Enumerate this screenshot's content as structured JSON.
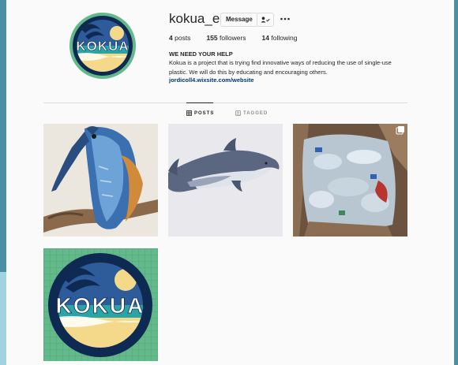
{
  "profile": {
    "username": "kokua_es",
    "avatar_logo_text": "KOKUA",
    "message_label": "Message",
    "posts_count": "4",
    "posts_label": "posts",
    "followers_count": "155",
    "followers_label": "followers",
    "following_count": "14",
    "following_label": "following",
    "bio_title": "WE NEED YOUR HELP",
    "bio_text": "Kokua is a project that is trying find innovative ways of reducing the use of single-use plastic. We will do this by educating and encouraging others.",
    "website": "jordicoll4.wixsite.com/website"
  },
  "tabs": [
    {
      "label": "POSTS",
      "icon": "grid-icon",
      "active": true
    },
    {
      "label": "TAGGED",
      "icon": "tag-icon",
      "active": false
    }
  ],
  "posts": [
    {
      "subject": "kingfisher bird carving"
    },
    {
      "subject": "dolphin illustration"
    },
    {
      "subject": "box of plastic bottles",
      "multiple": true
    },
    {
      "subject": "kokua logo",
      "logo_text": "KOKUA"
    }
  ],
  "colors": {
    "accent_strip": "#4a90a4",
    "logo_navy": "#0e2a52",
    "logo_green": "#63b98a",
    "link": "#00376b"
  }
}
